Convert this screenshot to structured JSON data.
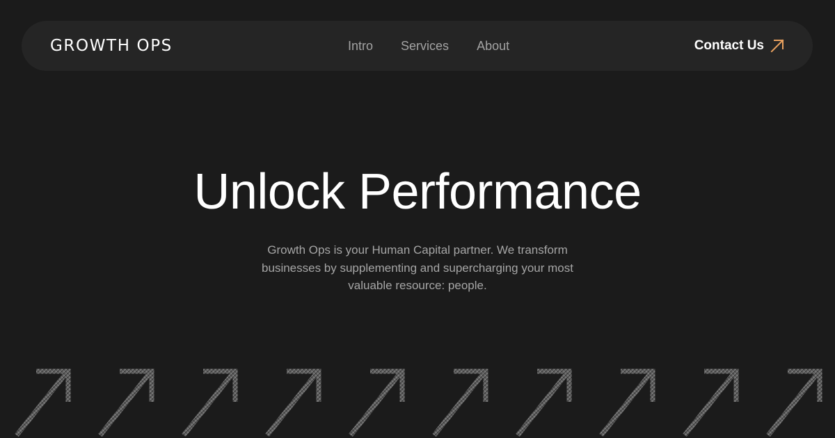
{
  "nav": {
    "logo": "GROWTH OPS",
    "links": [
      "Intro",
      "Services",
      "About"
    ],
    "contact_label": "Contact Us",
    "contact_icon": "arrow-up-right-icon"
  },
  "hero": {
    "title": "Unlock Performance",
    "subtitle": "Growth Ops is your Human Capital partner. We transform businesses by supplementing and supercharging your most valuable resource: people."
  },
  "decoration": {
    "icon": "arrow-up-right-icon",
    "count": 10
  },
  "colors": {
    "background": "#1b1b1b",
    "nav_background": "#252525",
    "accent": "#e9a15f",
    "text": "#ffffff",
    "muted_text": "#a3a3a3"
  }
}
